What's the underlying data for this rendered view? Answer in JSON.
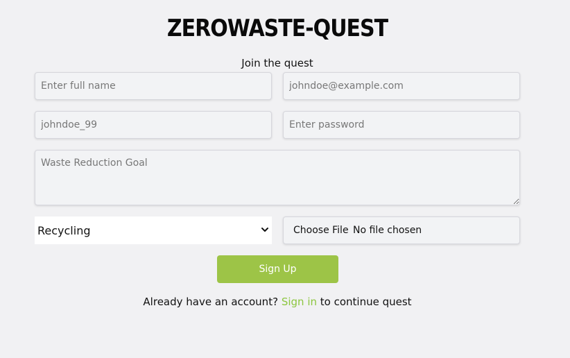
{
  "brand": {
    "title": "ZEROWASTE-QUEST"
  },
  "form": {
    "subtitle": "Join the quest",
    "full_name": {
      "placeholder": "Enter full name",
      "value": ""
    },
    "email": {
      "placeholder": "johndoe@example.com",
      "value": ""
    },
    "username": {
      "placeholder": "johndoe_99",
      "value": ""
    },
    "password": {
      "placeholder": "Enter password",
      "value": ""
    },
    "goal": {
      "placeholder": "Waste Reduction Goal",
      "value": ""
    },
    "category": {
      "selected": "Recycling"
    },
    "file": {
      "button_label": "Choose File",
      "status": "No file chosen"
    },
    "submit_label": "Sign Up"
  },
  "footer": {
    "prefix": "Already have an account?",
    "link_label": "Sign in",
    "suffix": "to continue quest"
  },
  "colors": {
    "accent": "#9dc447",
    "link": "#8cc63f",
    "background": "#f1f1f3"
  }
}
